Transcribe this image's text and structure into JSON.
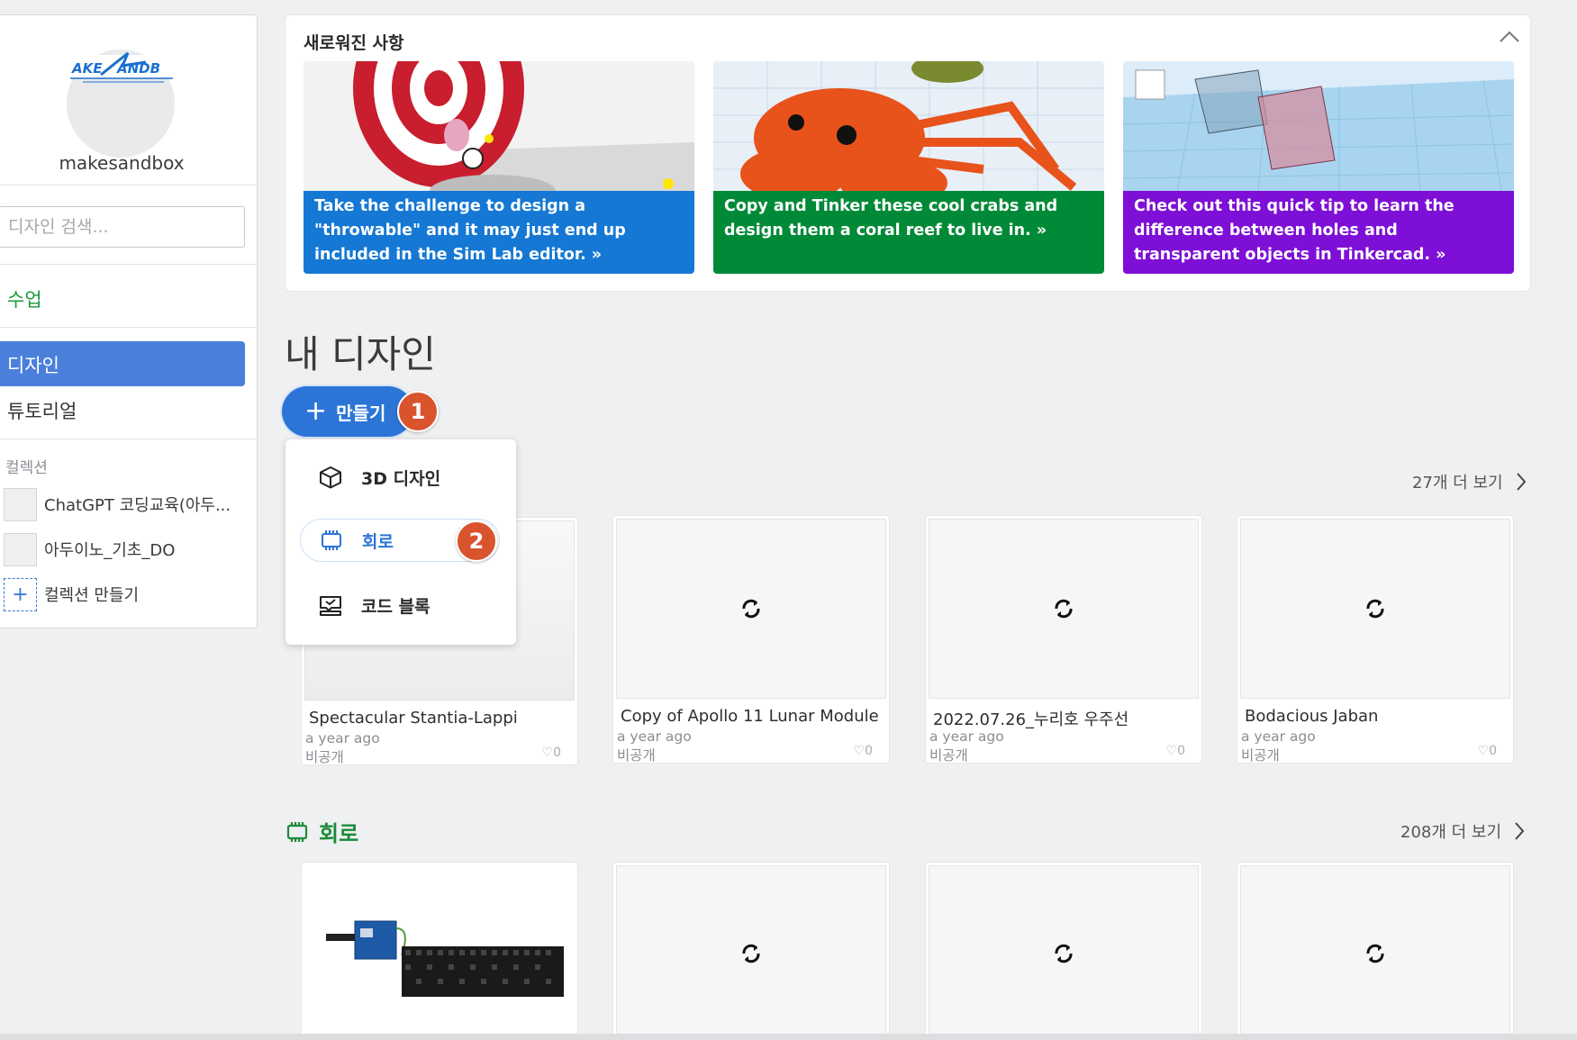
{
  "sidebar": {
    "username": "makesandbox",
    "search_placeholder": "디자인 검색...",
    "nav": {
      "class": "수업",
      "design": "디자인",
      "tutorial": "튜토리얼"
    },
    "collections_heading": "컬렉션",
    "collections": [
      {
        "label": "ChatGPT 코딩교육(아두..."
      },
      {
        "label": "아두이노_기초_DO"
      }
    ],
    "create_collection": "컬렉션 만들기"
  },
  "news": {
    "title": "새로워진 사항",
    "cards": [
      {
        "text": "Take the challenge to design a \"throwable\" and it may just end up included in the Sim Lab editor. »",
        "color": "#1478d4"
      },
      {
        "text": "Copy and Tinker these cool crabs and design them a coral reef to live in. »",
        "color": "#008a37"
      },
      {
        "text": "Check out this quick tip to learn the difference between holes and transparent objects in Tinkercad. »",
        "color": "#7d0fd6"
      }
    ]
  },
  "main": {
    "title": "내 디자인",
    "create_button": "만들기",
    "badges": {
      "one": "1",
      "two": "2"
    },
    "create_menu": [
      {
        "label": "3D 디자인",
        "icon": "cube-icon"
      },
      {
        "label": "회로",
        "icon": "circuit-icon"
      },
      {
        "label": "코드 블록",
        "icon": "code-blocks-icon"
      }
    ],
    "designs_section": {
      "more": "27개 더 보기",
      "items": [
        {
          "name": "Spectacular Stantia-Lappi",
          "time": "a year ago",
          "privacy": "비공개",
          "likes": "♡0"
        },
        {
          "name": "Copy of Apollo 11 Lunar Module",
          "time": "a year ago",
          "privacy": "비공개",
          "likes": "♡0"
        },
        {
          "name": "2022.07.26_누리호 우주선",
          "time": "a year ago",
          "privacy": "비공개",
          "likes": "♡0"
        },
        {
          "name": "Bodacious Jaban",
          "time": "a year ago",
          "privacy": "비공개",
          "likes": "♡0"
        }
      ]
    },
    "circuits_section": {
      "title": "회로",
      "more": "208개 더 보기"
    }
  },
  "colors": {
    "accent": "#2c75d6",
    "nav_active": "#4a80db",
    "green": "#1b8b3a",
    "badge": "#d9532d"
  }
}
